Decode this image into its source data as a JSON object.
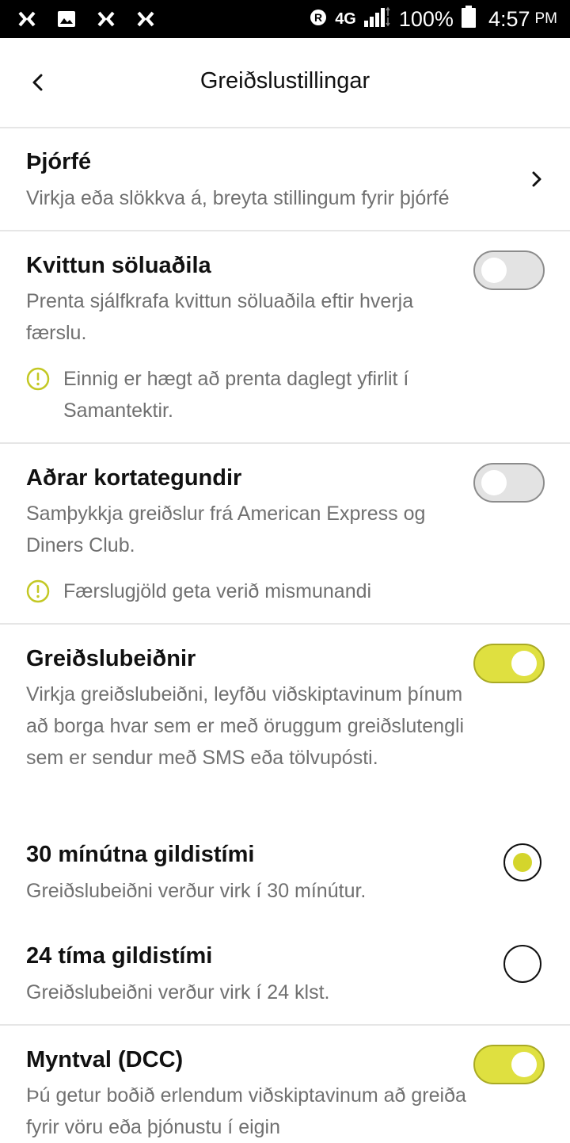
{
  "status_bar": {
    "network": "4G",
    "battery": "100%",
    "time": "4:57",
    "ampm": "PM"
  },
  "header": {
    "title": "Greiðslustillingar"
  },
  "tips": {
    "title": "Þjórfé",
    "description": "Virkja eða slökkva á, breyta stillingum fyrir þjórfé"
  },
  "merchant_receipt": {
    "title": "Kvittun söluaðila",
    "description": "Prenta sjálfkrafa kvittun söluaðila eftir hverja færslu.",
    "info": "Einnig er hægt að prenta daglegt yfirlit í Samantektir.",
    "enabled": false
  },
  "other_cards": {
    "title": "Aðrar kortategundir",
    "description": "Samþykkja greiðslur frá American Express og Diners Club.",
    "info": "Færslugjöld geta verið mismunandi",
    "enabled": false
  },
  "payment_requests": {
    "title": "Greiðslubeiðnir",
    "description": "Virkja greiðslubeiðni, leyfðu viðskiptavinum þínum að borga hvar sem er með öruggum greiðslutengli sem er sendur með SMS eða tölvupósti.",
    "enabled": true,
    "options": [
      {
        "title": "30 mínútna gildistími",
        "description": "Greiðslubeiðni verður virk í 30 mínútur.",
        "selected": true
      },
      {
        "title": "24 tíma gildistími",
        "description": "Greiðslubeiðni verður virk í 24 klst.",
        "selected": false
      }
    ]
  },
  "dcc": {
    "title": "Myntval (DCC)",
    "description": "Þú getur boðið erlendum viðskiptavinum að greiða fyrir vöru eða þjónustu í eigin",
    "enabled": true
  },
  "colors": {
    "accent": "#dfe040",
    "info_icon": "#c3c824",
    "text_secondary": "#707070"
  }
}
